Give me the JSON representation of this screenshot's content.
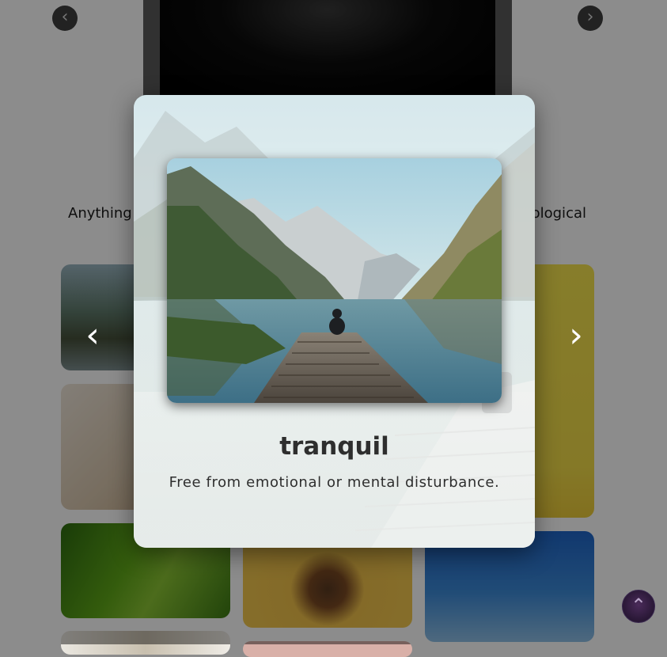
{
  "background": {
    "tagline_left": "Anything",
    "tagline_right": "ological",
    "hero_prev_icon": "chevron-left-icon",
    "hero_next_icon": "chevron-right-icon"
  },
  "modal": {
    "title": "tranquil",
    "description": "Free from emotional or mental disturbance.",
    "prev_icon": "chevron-left-icon",
    "next_icon": "chevron-right-icon"
  },
  "scroll_top": {
    "icon": "chevron-up-icon"
  }
}
